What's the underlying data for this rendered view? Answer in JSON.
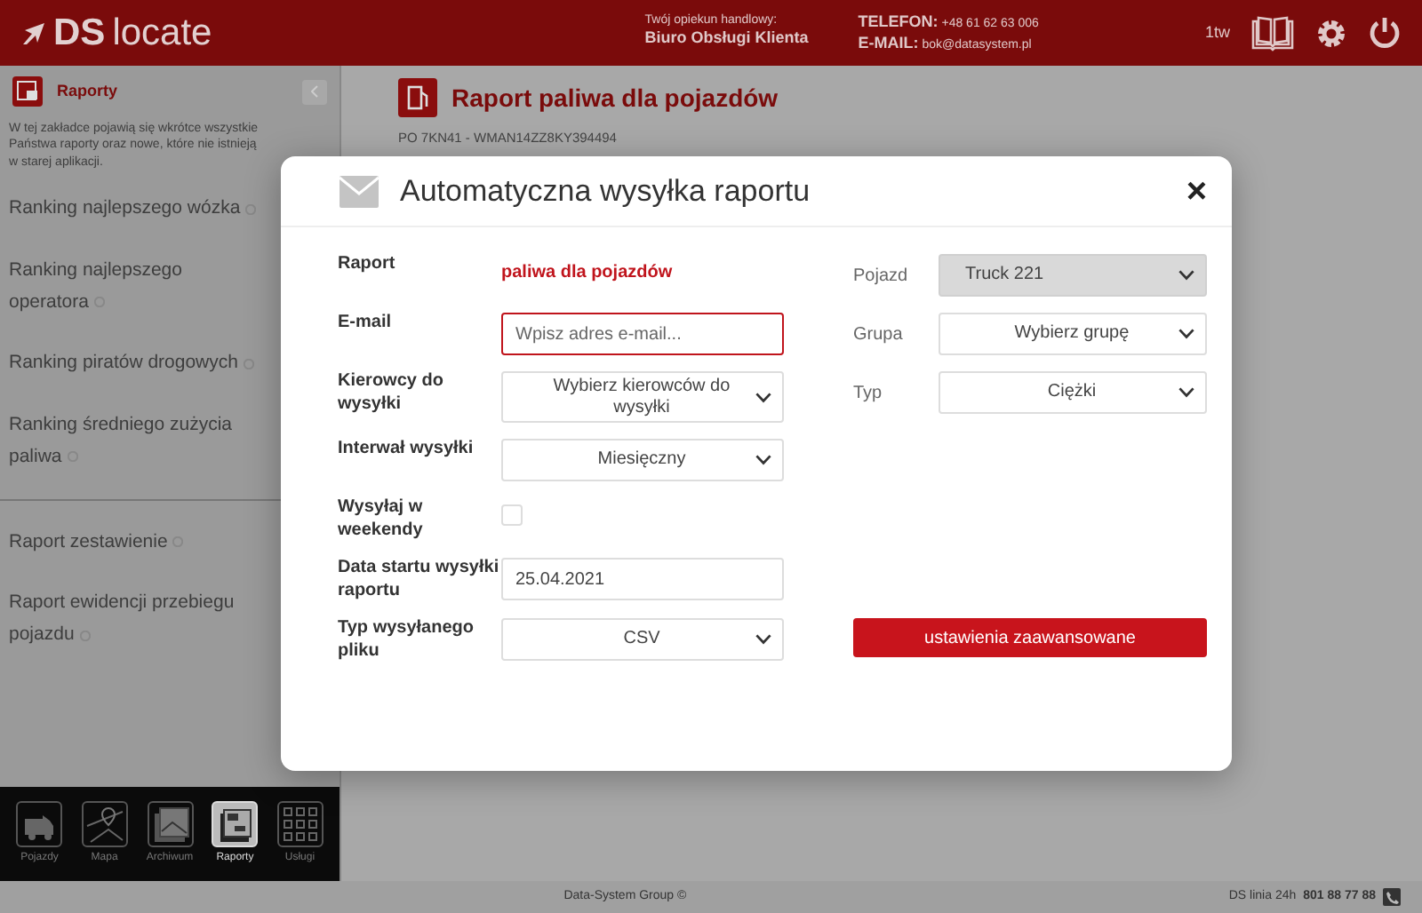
{
  "header": {
    "logo_main": "DS",
    "logo_rest": "locate",
    "contact_label": "Twój opiekun handlowy:",
    "contact_name": "Biuro Obsługi Klienta",
    "phone_label": "TELEFON:",
    "phone": "+48 61 62 63 006",
    "email_label": "E-MAIL:",
    "email": "bok@datasystem.pl",
    "user": "1tw"
  },
  "sidebar": {
    "title": "Raporty",
    "description": "W tej zakładce pojawią się wkrótce wszystkie Państwa raporty oraz nowe, które nie istnieją w starej aplikacji.",
    "sections": [
      [
        {
          "label": "Ranking najlepszego wózka"
        },
        {
          "label": "Ranking najlepszego operatora"
        },
        {
          "label": "Ranking piratów drogowych"
        },
        {
          "label": "Ranking średniego zużycia paliwa"
        }
      ],
      [
        {
          "label": "Raport zestawienie"
        },
        {
          "label": "Raport ewidencji przebiegu pojazdu"
        }
      ]
    ],
    "dock": [
      {
        "kind": "van",
        "label": "Pojazdy",
        "selected": false
      },
      {
        "kind": "map",
        "label": "Mapa",
        "selected": false
      },
      {
        "kind": "archive",
        "label": "Archiwum",
        "selected": false
      },
      {
        "kind": "reports",
        "label": "Raporty",
        "selected": true
      },
      {
        "kind": "grid",
        "label": "Usługi",
        "selected": false
      }
    ]
  },
  "page": {
    "title": "Raport paliwa dla pojazdów",
    "subtitle": "PO 7KN41 - WMAN14ZZ8KY394494"
  },
  "modal": {
    "title": "Automatyczna wysyłka raportu",
    "close": "×",
    "rows": [
      {
        "left": {
          "kind": "text",
          "label": "Raport",
          "value": "paliwa dla pojazdów"
        },
        "right": {
          "kind": "select",
          "label": "Pojazd",
          "value": "Truck 221",
          "disabled": true
        }
      },
      {
        "left": {
          "kind": "input",
          "label": "E-mail",
          "placeholder": "Wpisz adres e-mail...",
          "invalid": true
        },
        "right": {
          "kind": "select",
          "label": "Grupa",
          "value": "Wybierz grupę",
          "disabled": false
        }
      },
      {
        "left": {
          "kind": "select",
          "label": "Kierowcy do wysyłki",
          "value": "Wybierz kierowców do wysyłki",
          "disabled": false
        },
        "right": {
          "kind": "select",
          "label": "Typ",
          "value": "Ciężki",
          "disabled": false
        }
      },
      {
        "left": {
          "kind": "select",
          "label": "Interwał wysyłki",
          "value": "Miesięczny",
          "disabled": false
        }
      },
      {
        "left": {
          "kind": "checkbox",
          "label": "Wysyłaj w weekendy",
          "checked": false
        }
      },
      {
        "left": {
          "kind": "date",
          "label": "Data startu wysyłki raportu",
          "value": "25.04.2021"
        }
      },
      {
        "left": {
          "kind": "select",
          "label": "Typ wysyłanego pliku",
          "value": "CSV",
          "disabled": false
        },
        "right": {
          "kind": "button",
          "label": "ustawienia zaawansowane"
        }
      }
    ]
  },
  "footer": {
    "copyright": "Data-System Group ©",
    "hotline_label": "DS linia 24h",
    "hotline_number": "801 88 77 88"
  }
}
